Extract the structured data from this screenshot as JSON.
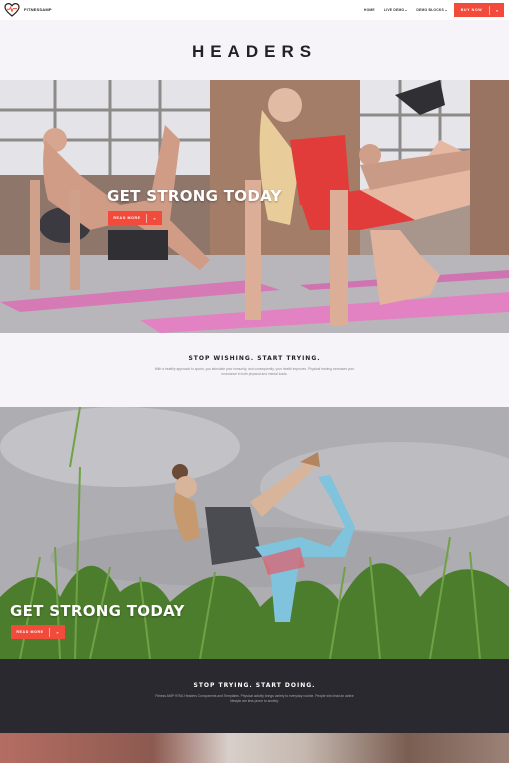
{
  "brand": {
    "name": "FITNESSAMP",
    "logo_icon": "heart-pulse-icon"
  },
  "nav": {
    "links": [
      {
        "label": "HOME",
        "has_dropdown": false
      },
      {
        "label": "LIVE DEMO",
        "has_dropdown": true
      },
      {
        "label": "DEMO BLOCKS",
        "has_dropdown": true
      }
    ],
    "cta_label": "BUY NOW",
    "cta_arrow": "»"
  },
  "page_title": "HEADERS",
  "hero_one": {
    "heading": "GET STRONG TODAY",
    "button_label": "READ MORE",
    "button_arrow": "»"
  },
  "promo_one": {
    "heading": "STOP WISHING. START TRYING.",
    "body": "With a healthy approach to sports, you stimulate your immunity, and consequently, your health improves. Physical training increases your endurance in both physical and mental loads."
  },
  "hero_two": {
    "heading": "GET STRONG TODAY",
    "button_label": "READ MORE",
    "button_arrow": "»"
  },
  "promo_two": {
    "heading": "STOP TRYING. START DOING.",
    "body": "Fitness AMP HTML Headers Components and Templates. Physical activity brings variety to everyday routine. People who lead an active lifestyle are less prone to anxiety."
  },
  "colors": {
    "accent": "#f24b3b",
    "light_band": "#f6f4f9",
    "dark_band": "#2b2930"
  }
}
